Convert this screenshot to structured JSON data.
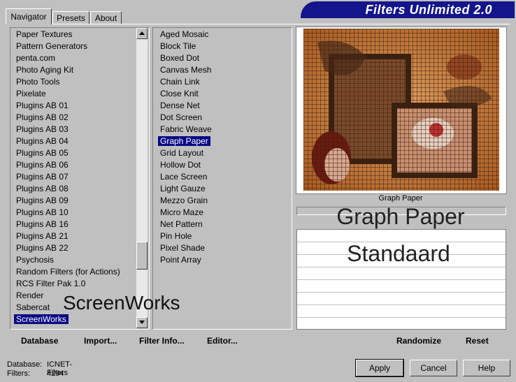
{
  "tabs": [
    "Navigator",
    "Presets",
    "About"
  ],
  "banner_title": "Filters Unlimited 2.0",
  "categories": [
    "Paper Textures",
    "Pattern Generators",
    "penta.com",
    "Photo Aging Kit",
    "Photo Tools",
    "Pixelate",
    "Plugins AB 01",
    "Plugins AB 02",
    "Plugins AB 03",
    "Plugins AB 04",
    "Plugins AB 05",
    "Plugins AB 06",
    "Plugins AB 07",
    "Plugins AB 08",
    "Plugins AB 09",
    "Plugins AB 10",
    "Plugins AB 16",
    "Plugins AB 21",
    "Plugins AB 22",
    "Psychosis",
    "Random Filters (for Actions)",
    "RCS Filter Pak 1.0",
    "Render",
    "Sabercat",
    "ScreenWorks"
  ],
  "selected_category": "ScreenWorks",
  "filters": [
    "Aged Mosaic",
    "Block Tile",
    "Boxed Dot",
    "Canvas Mesh",
    "Chain Link",
    "Close Knit",
    "Dense Net",
    "Dot Screen",
    "Fabric Weave",
    "Graph Paper",
    "Grid Layout",
    "Hollow Dot",
    "Lace Screen",
    "Light Gauze",
    "Mezzo Grain",
    "Micro Maze",
    "Net Pattern",
    "Pin Hole",
    "Pixel Shade",
    "Point Array"
  ],
  "selected_filter": "Graph Paper",
  "overlay_label": "ScreenWorks",
  "preview_caption": "Graph Paper",
  "preview_big_title": "Graph Paper",
  "preview_big_sub": "Standaard",
  "links": {
    "database": "Database",
    "import": "Import...",
    "filter_info": "Filter Info...",
    "editor": "Editor...",
    "randomize": "Randomize",
    "reset": "Reset"
  },
  "status": {
    "database_label": "Database:",
    "database_value": "ICNET-Filters",
    "filters_label": "Filters:",
    "filters_value": "4294"
  },
  "buttons": {
    "apply": "Apply",
    "cancel": "Cancel",
    "help": "Help"
  },
  "colors": {
    "banner": "#14148c",
    "selection": "#0a0a84",
    "grid_orange": "#c8762e"
  }
}
